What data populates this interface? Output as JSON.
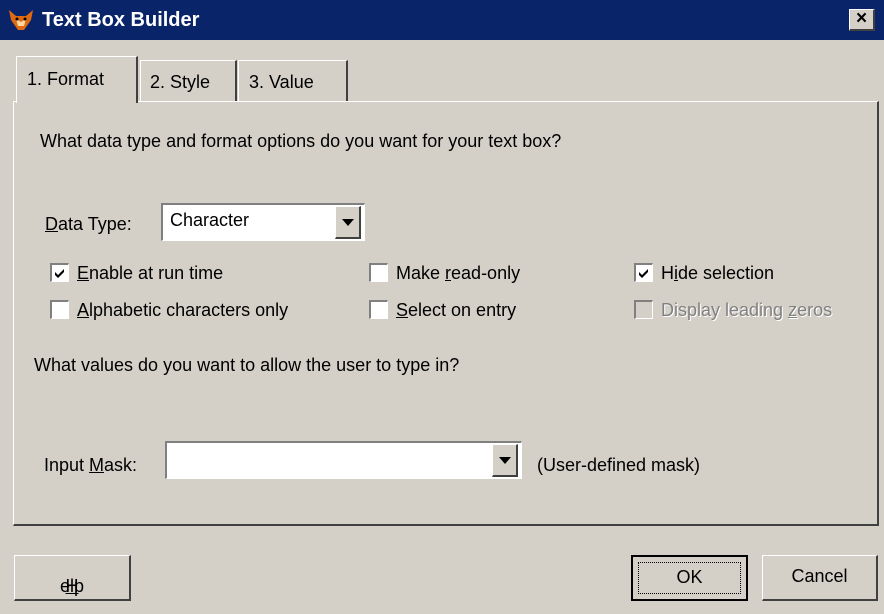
{
  "window": {
    "title": "Text Box Builder",
    "close_label": "×"
  },
  "tabs": [
    {
      "label": "1. Format",
      "selected": true
    },
    {
      "label": "2. Style",
      "selected": false
    },
    {
      "label": "3. Value",
      "selected": false
    }
  ],
  "format": {
    "question1": "What data type and format options do you want for your text box?",
    "data_type": {
      "label_prefix": "D",
      "label_rest": "ata Type:",
      "value": "Character"
    },
    "checkboxes": {
      "enable_run_time": {
        "label_prefix": "E",
        "label_rest": "nable at run time",
        "checked": true
      },
      "alphabetic_only": {
        "label_prefix": "A",
        "label_rest": "lphabetic characters only",
        "checked": false
      },
      "make_read_only": {
        "label_start": "Make ",
        "label_ul": "r",
        "label_end": "ead-only",
        "checked": false
      },
      "select_on_entry": {
        "label_prefix": "S",
        "label_rest": "elect on entry",
        "checked": false
      },
      "hide_selection": {
        "label_start": "H",
        "label_ul": "i",
        "label_end": "de selection",
        "checked": true
      },
      "display_leading_zeros": {
        "label_start": "Display leading ",
        "label_ul": "z",
        "label_end": "eros",
        "checked": false,
        "disabled": true
      }
    },
    "question2": "What values do you want to allow the user to type in?",
    "input_mask": {
      "label_start": "Input ",
      "label_ul": "M",
      "label_end": "ask:",
      "value": "",
      "hint": "(User-defined mask)"
    }
  },
  "buttons": {
    "help": {
      "label_ul": "H",
      "label_rest": "elp"
    },
    "ok": "OK",
    "cancel": "Cancel"
  }
}
